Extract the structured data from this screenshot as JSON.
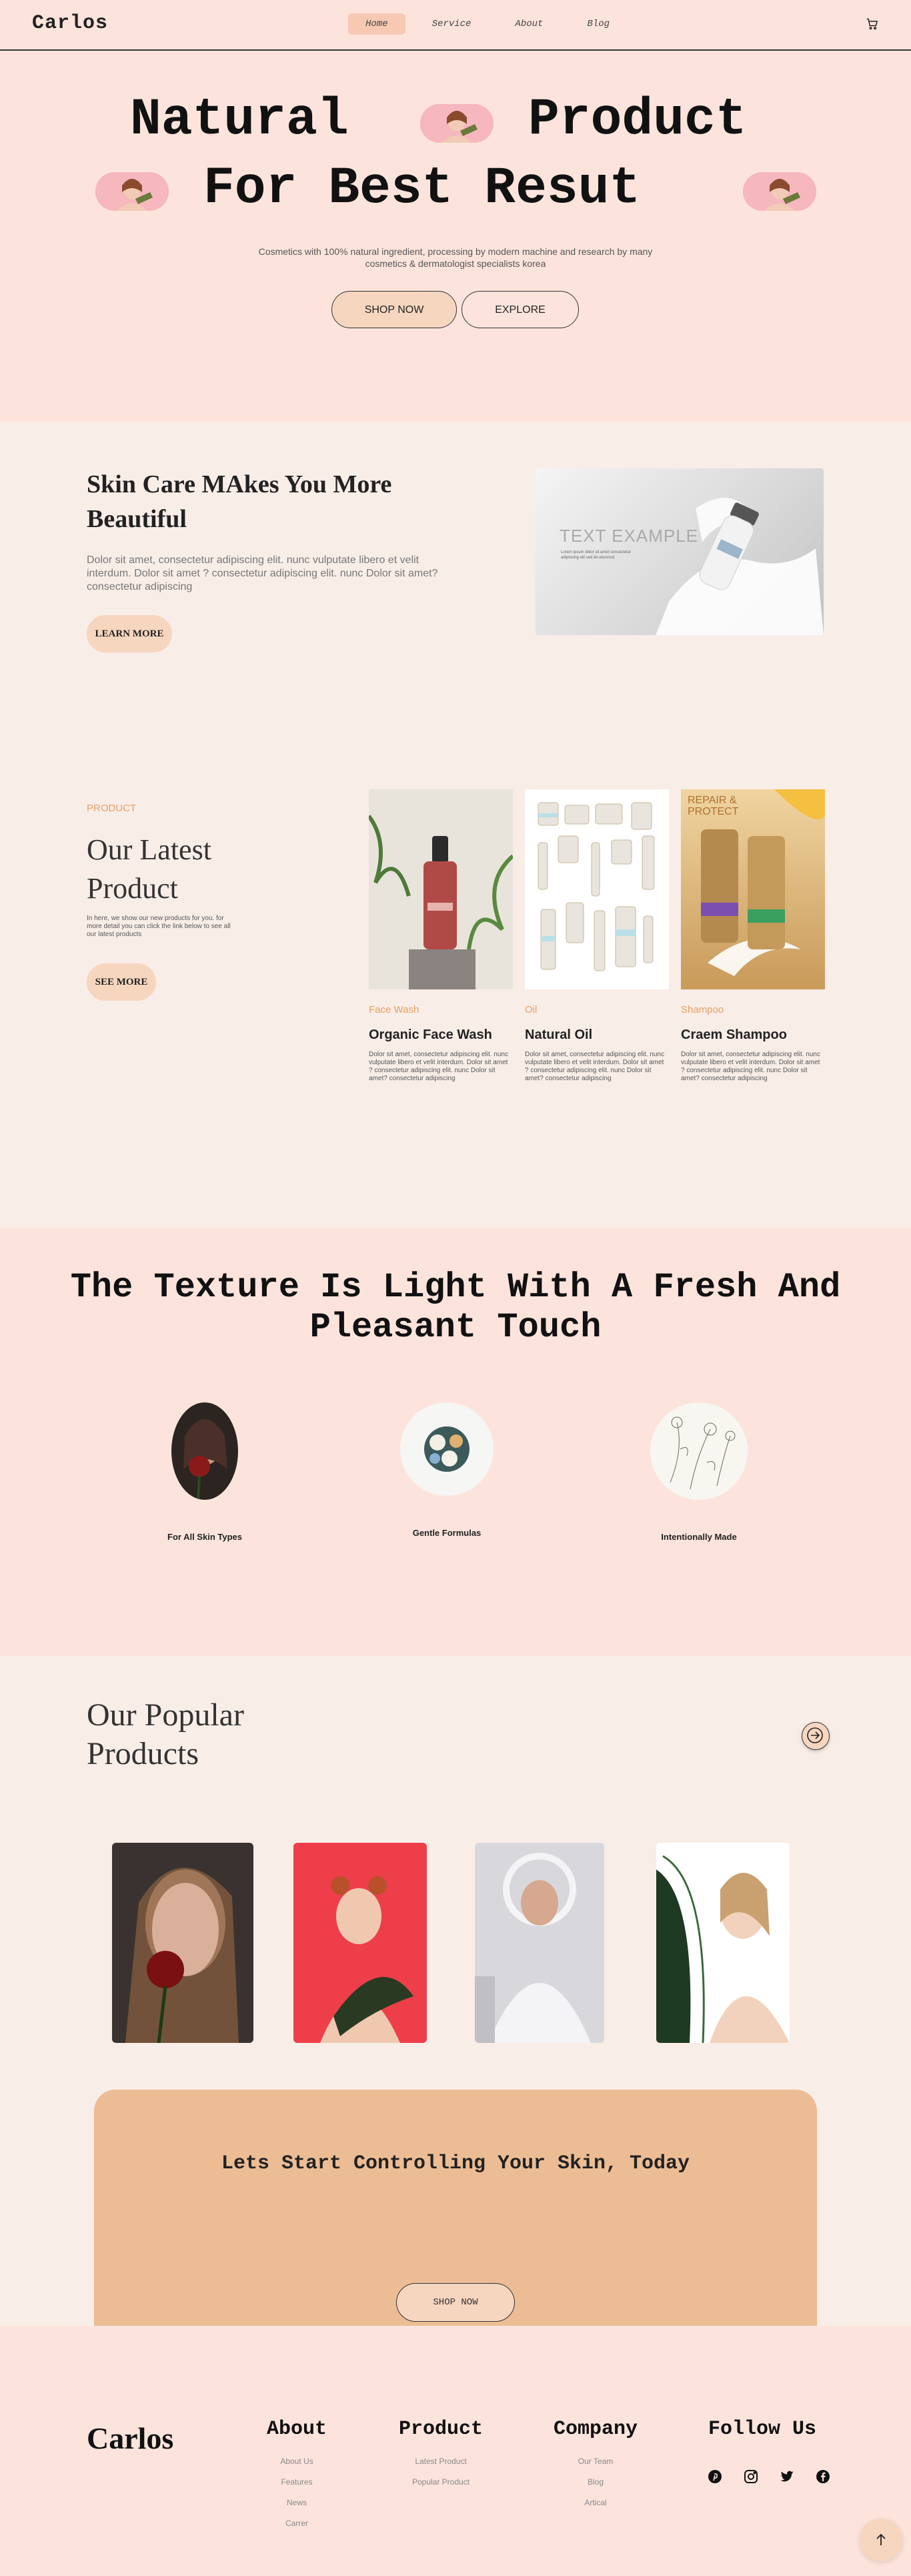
{
  "nav": {
    "logo": "Carlos",
    "links": [
      "Home",
      "Service",
      "About",
      "Blog"
    ],
    "active": "Home",
    "cart_icon": "cart-icon"
  },
  "hero": {
    "line1_left": "Natural",
    "line1_right": "Product",
    "line2": "For Best Resut",
    "subtitle": "Cosmetics with 100% natural ingredient, processing by modern machine and research by many cosmetics & dermatologist specialists korea",
    "shop_button": "SHOP NOW",
    "explore_button": "EXPLORE"
  },
  "skincare": {
    "title": "Skin Care MAkes You More Beautiful",
    "text": "Dolor sit amet, consectetur adipiscing elit. nunc vulputate libero et velit interdum. Dolor sit amet ? consectetur adipiscing elit. nunc Dolor sit amet? consectetur adipiscing",
    "button": "LEARN MORE",
    "image_text": "TEXT EXAMPLE",
    "image_small": "Lorem ipsum dolor sit amet consectetur adipiscing elit sed do eiusmod"
  },
  "latest": {
    "tag": "PRODUCT",
    "title": "Our Latest Product",
    "text": "In here, we show our new products for you. for more detail you can click the link below to see all our latest products",
    "button": "SEE MORE",
    "cards": [
      {
        "category": "Face Wash",
        "name": "Organic Face Wash",
        "desc": "Dolor sit amet, consectetur adipiscing elit. nunc vulputate libero et velit interdum. Dolor sit amet ? consectetur adipiscing elit. nunc Dolor sit amet? consectetur adipiscing"
      },
      {
        "category": "Oil",
        "name": "Natural Oil",
        "desc": "Dolor sit amet, consectetur adipiscing elit. nunc vulputate libero et velit interdum. Dolor sit amet ? consectetur adipiscing elit. nunc Dolor sit amet? consectetur adipiscing"
      },
      {
        "category": "Shampoo",
        "name": "Craem Shampoo",
        "desc": "Dolor sit amet, consectetur adipiscing elit. nunc vulputate libero et velit interdum. Dolor sit amet ? consectetur adipiscing elit. nunc Dolor sit amet? consectetur adipiscing"
      }
    ],
    "shampoo_label": "REPAIR & PROTECT"
  },
  "texture": {
    "title": "The Texture Is Light With A Fresh And Pleasant Touch",
    "features": [
      "For All Skin Types",
      "Gentle Formulas",
      "Intentionally Made"
    ]
  },
  "popular": {
    "title": "Our Popular Products",
    "arrow_icon": "arrow-right-icon"
  },
  "cta": {
    "text": "Lets Start Controlling Your Skin, Today",
    "button": "SHOP NOW"
  },
  "footer": {
    "logo": "Carlos",
    "columns": [
      {
        "heading": "About",
        "links": [
          "About Us",
          "Features",
          "News",
          "Carrer"
        ]
      },
      {
        "heading": "Product",
        "links": [
          "Latest Product",
          "Popular Product"
        ]
      },
      {
        "heading": "Company",
        "links": [
          "Our Team",
          "Blog",
          "Artical"
        ]
      },
      {
        "heading": "Follow Us",
        "links": []
      }
    ],
    "social_icons": [
      "pinterest-icon",
      "instagram-icon",
      "twitter-icon",
      "facebook-icon"
    ],
    "back_to_top_icon": "arrow-up-icon"
  },
  "colors": {
    "hero_bg": "#fce4dc",
    "accent": "#f7d6c0",
    "orange_text": "#e8a060",
    "cta_bg": "#ecbd95"
  }
}
